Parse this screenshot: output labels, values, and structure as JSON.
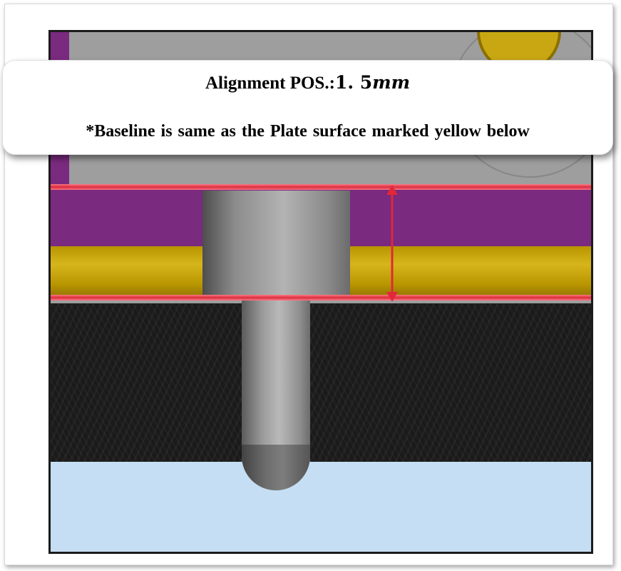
{
  "callout": {
    "title_label": "Alignment POS.:",
    "title_value": "1. 5",
    "title_unit": "mm",
    "note": "*Baseline is same as the Plate surface marked yellow below"
  },
  "diagram": {
    "layers": [
      {
        "name": "upper plate",
        "color": "#9e9e9e"
      },
      {
        "name": "purple layer",
        "color": "#7a2a7f"
      },
      {
        "name": "yellow plate surface",
        "color": "#c9a712"
      },
      {
        "name": "black layer",
        "color": "#1a1a1a"
      },
      {
        "name": "blue base",
        "color": "#c5def3"
      }
    ],
    "dimension_mm": 1.5,
    "colors": {
      "marker": "#e0283a",
      "pin": "#9a9a9a"
    }
  }
}
